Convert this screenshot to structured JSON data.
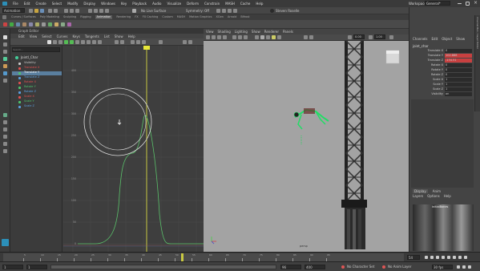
{
  "menubar": {
    "items": [
      "File",
      "Edit",
      "Create",
      "Select",
      "Modify",
      "Display",
      "Windows",
      "Key",
      "Playback",
      "Audio",
      "Visualize",
      "Deform",
      "Constrain",
      "MASH",
      "Cache",
      "Help"
    ],
    "workspace_label": "Workspace:",
    "workspace_value": "General*"
  },
  "statusline": {
    "mode": "Animation",
    "no_live_surface": "No Live Surface",
    "symmetry": "Symmetry: Off",
    "sign_in": "Steven Roselle"
  },
  "shelf_tabs": [
    "Curves / Surfaces",
    "Poly Modeling",
    "Sculpting",
    "Rigging",
    "Animation",
    "Rendering",
    "FX",
    "FX Caching",
    "Custom",
    "MASH",
    "Motion Graphics",
    "XGen",
    "Arnold",
    "Bifrost"
  ],
  "shelf_active": "Animation",
  "graph_editor": {
    "title": "Graph Editor",
    "menu": [
      "Edit",
      "View",
      "Select",
      "Curves",
      "Keys",
      "Tangents",
      "List",
      "Show",
      "Help"
    ],
    "search_placeholder": "Search...",
    "outliner": {
      "root": "Jointl_Char",
      "channels": [
        {
          "label": "Visibility",
          "color": "#c9c9c9"
        },
        {
          "label": "Translate X",
          "color": "#e05050"
        },
        {
          "label": "Translate Y",
          "color": "#4cc46c",
          "selected": true
        },
        {
          "label": "Translate Z",
          "color": "#5aa0e0"
        },
        {
          "label": "Rotate X",
          "color": "#e05050"
        },
        {
          "label": "Rotate Y",
          "color": "#4cc46c"
        },
        {
          "label": "Rotate Z",
          "color": "#5aa0e0"
        },
        {
          "label": "Scale X",
          "color": "#e05050"
        },
        {
          "label": "Scale Y",
          "color": "#4cc46c"
        },
        {
          "label": "Scale Z",
          "color": "#5aa0e0"
        }
      ]
    },
    "y_labels": [
      "400",
      "350",
      "300",
      "250",
      "200",
      "150",
      "100",
      "50",
      "0"
    ],
    "current_frame": "54"
  },
  "viewport": {
    "menu": [
      "View",
      "Shading",
      "Lighting",
      "Show",
      "Renderer",
      "Panels"
    ],
    "camera_label": "persp",
    "gamma_value": "1.00",
    "exposure_value": "0.00"
  },
  "channelbox": {
    "side_tab": "Channel Box / Layer Editor",
    "menu": [
      "Channels",
      "Edit",
      "Object",
      "Show"
    ],
    "object_name": "joint_char",
    "attributes": [
      {
        "label": "Translate X",
        "value": "0"
      },
      {
        "label": "Translate Y",
        "value": "102.888"
      },
      {
        "label": "Translate Z",
        "value": "-134.51"
      },
      {
        "label": "Rotate X",
        "value": "0"
      },
      {
        "label": "Rotate Y",
        "value": "0"
      },
      {
        "label": "Rotate Z",
        "value": "0"
      },
      {
        "label": "Scale X",
        "value": "1"
      },
      {
        "label": "Scale Y",
        "value": "1"
      },
      {
        "label": "Scale Z",
        "value": "1"
      },
      {
        "label": "Visibility",
        "value": "on"
      }
    ],
    "layer_tabs": [
      "Display",
      "Anim"
    ],
    "layer_menu": [
      "Layers",
      "Options",
      "Help"
    ],
    "layer_name": "initialBones"
  },
  "timeslider": {
    "ticks": [
      "5",
      "10",
      "15",
      "20",
      "25",
      "30",
      "35",
      "40",
      "45",
      "50",
      "55",
      "60",
      "65",
      "70",
      "75",
      "80",
      "85",
      "90",
      "95"
    ],
    "current_frame": "54"
  },
  "rangeslider": {
    "start": "1",
    "range_start": "1",
    "range_end": "96",
    "end": "400",
    "character_set": "No Character Set",
    "anim_layer": "No Anim Layer",
    "fps": "30 fps"
  }
}
